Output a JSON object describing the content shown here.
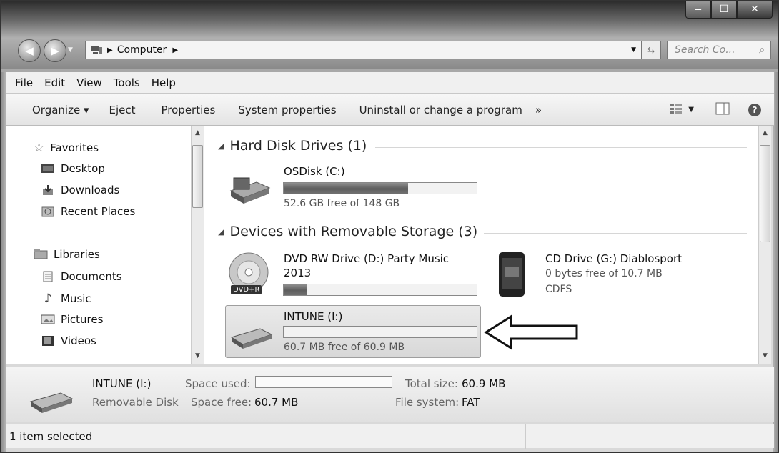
{
  "window": {
    "caption_buttons": {
      "minimize": "‒",
      "maximize": "☐",
      "close": "✕"
    }
  },
  "nav": {
    "breadcrumb_location": "Computer",
    "search_placeholder": "Search Co..."
  },
  "menu": [
    "File",
    "Edit",
    "View",
    "Tools",
    "Help"
  ],
  "toolbar": {
    "organize": "Organize ▾",
    "eject": "Eject",
    "properties": "Properties",
    "system_properties": "System properties",
    "uninstall": "Uninstall or change a program",
    "more": "»"
  },
  "sidebar": {
    "favorites": {
      "label": "Favorites",
      "items": [
        "Desktop",
        "Downloads",
        "Recent Places"
      ]
    },
    "libraries": {
      "label": "Libraries",
      "items": [
        "Documents",
        "Music",
        "Pictures",
        "Videos"
      ]
    }
  },
  "content": {
    "hard_disk_group": "Hard Disk Drives (1)",
    "removable_group": "Devices with Removable Storage (3)",
    "drives": {
      "osdisk": {
        "name": "OSDisk (C:)",
        "free_text": "52.6 GB free of 148 GB",
        "used_fraction": 0.645
      },
      "dvd": {
        "name": "DVD RW Drive (D:) Party Music",
        "name2": "2013",
        "icon_label": "DVD+R",
        "used_fraction": 0.12
      },
      "cd": {
        "name": "CD Drive (G:) Diablosport",
        "free_text": "0 bytes free of 10.7 MB",
        "fs": "CDFS"
      },
      "intune": {
        "name": "INTUNE (I:)",
        "free_text": "60.7 MB free of 60.9 MB",
        "used_fraction": 0.003
      }
    }
  },
  "details": {
    "name": "INTUNE (I:)",
    "type": "Removable Disk",
    "space_used_label": "Space used:",
    "space_free_label": "Space free:",
    "space_free_value": "60.7 MB",
    "total_size_label": "Total size:",
    "total_size_value": "60.9 MB",
    "file_system_label": "File system:",
    "file_system_value": "FAT"
  },
  "status": {
    "text": "1 item selected"
  }
}
